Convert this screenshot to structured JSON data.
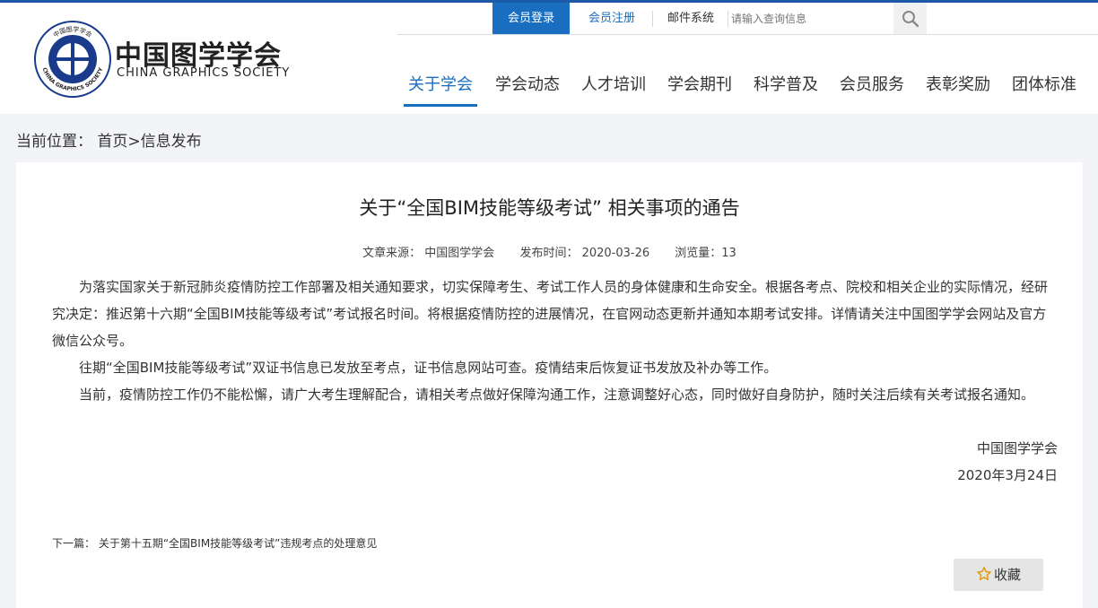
{
  "logo": {
    "name_cn": "中国图学学会",
    "name_en": "CHINA GRAPHICS SOCIETY",
    "ring_text_top": "中国图学学会",
    "ring_text_bottom": "CHINA GRAPHICS SOCIETY",
    "color": "#1a3b8c"
  },
  "topbar": {
    "login_label": "会员登录",
    "register_label": "会员注册",
    "mail_label": "邮件系统",
    "search_placeholder": "请输入查询信息",
    "search_icon": "search-icon"
  },
  "nav": {
    "items": [
      "关于学会",
      "学会动态",
      "人才培训",
      "学会期刊",
      "科学普及",
      "会员服务",
      "表彰奖励",
      "团体标准"
    ],
    "active_index": 0
  },
  "breadcrumb": {
    "text": "当前位置： 首页>信息发布"
  },
  "article": {
    "title": "关于“全国BIM技能等级考试” 相关事项的通告",
    "source": "文章来源： 中国图学学会",
    "date": "发布时间： 2020-03-26",
    "views": "浏览量：13",
    "paragraphs": [
      "为落实国家关于新冠肺炎疫情防控工作部署及相关通知要求，切实保障考生、考试工作人员的身体健康和生命安全。根据各考点、院校和相关企业的实际情况，经研究决定：推迟第十六期“全国BIM技能等级考试”考试报名时间。将根据疫情防控的进展情况，在官网动态更新并通知本期考试安排。详情请关注中国图学学会网站及官方微信公众号。",
      "往期“全国BIM技能等级考试”双证书信息已发放至考点，证书信息网站可查。疫情结束后恢复证书发放及补办等工作。",
      "当前，疫情防控工作仍不能松懈，请广大考生理解配合，请相关考点做好保障沟通工作，注意调整好心态，同时做好自身防护，随时关注后续有关考试报名通知。"
    ],
    "signature": "中国图学学会",
    "sign_date": "2020年3月24日",
    "next_label": "下一篇：",
    "next_title": "关于第十五期“全国BIM技能等级考试”违规考点的处理意见",
    "favorite_label": "收藏",
    "favorite_icon": "star-icon"
  },
  "colors": {
    "accent": "#1a6ec0",
    "page_bg": "#f3f4f7"
  }
}
